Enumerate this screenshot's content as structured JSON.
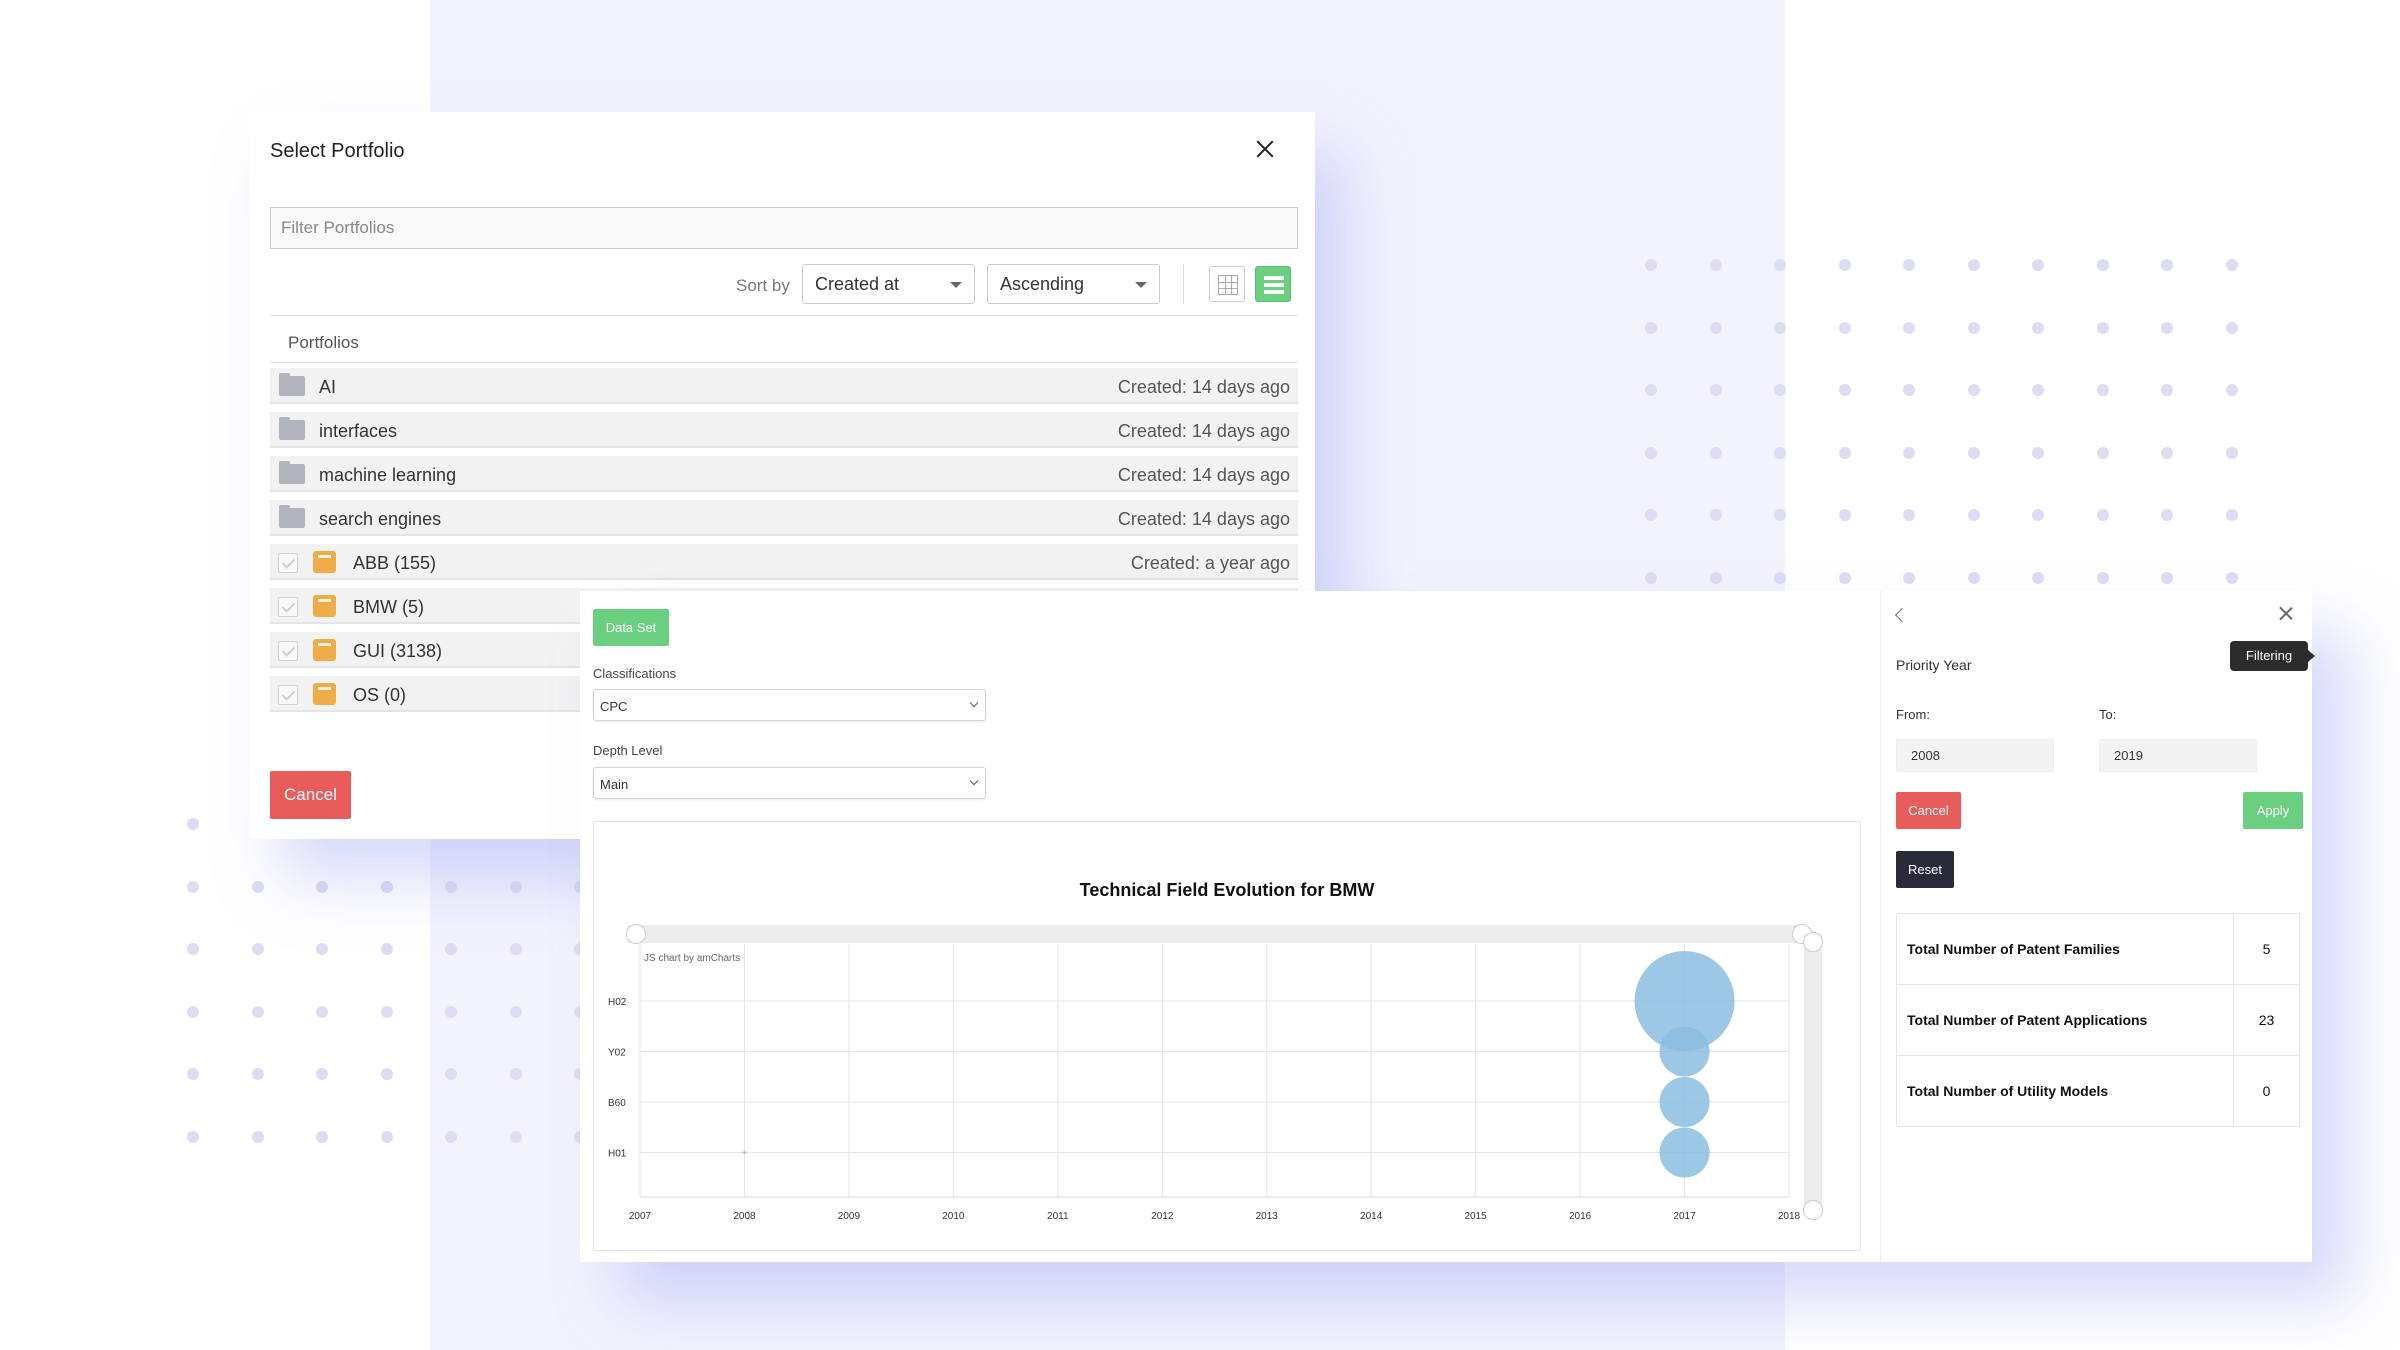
{
  "portfolio_modal": {
    "title": "Select Portfolio",
    "filter_placeholder": "Filter Portfolios",
    "sort_label": "Sort by",
    "sort_field": "Created at",
    "sort_order": "Ascending",
    "list_header": "Portfolios",
    "folders": [
      {
        "name": "AI",
        "created": "Created: 14 days ago"
      },
      {
        "name": "interfaces",
        "created": "Created: 14 days ago"
      },
      {
        "name": "machine learning",
        "created": "Created: 14 days ago"
      },
      {
        "name": "search engines",
        "created": "Created: 14 days ago"
      }
    ],
    "portfolios": [
      {
        "name": "ABB (155)",
        "created": "Created: a year ago"
      },
      {
        "name": "BMW (5)",
        "created": ""
      },
      {
        "name": "GUI (3138)",
        "created": ""
      },
      {
        "name": "OS (0)",
        "created": ""
      }
    ],
    "cancel_label": "Cancel"
  },
  "analysis": {
    "dataset_label": "Data Set",
    "classifications_label": "Classifications",
    "classifications_value": "CPC",
    "depth_label": "Depth Level",
    "depth_value": "Main",
    "credit": "JS chart by amCharts"
  },
  "filter_panel": {
    "heading": "Priority Year",
    "tooltip": "Filtering",
    "from_label": "From:",
    "to_label": "To:",
    "from_value": "2008",
    "to_value": "2019",
    "cancel_label": "Cancel",
    "apply_label": "Apply",
    "reset_label": "Reset",
    "stats": [
      {
        "label": "Total Number of Patent Families",
        "value": "5"
      },
      {
        "label": "Total Number of Patent Applications",
        "value": "23"
      },
      {
        "label": "Total Number of Utility Models",
        "value": "0"
      }
    ]
  },
  "colors": {
    "accent_green": "#6acf7f",
    "danger_red": "#e85c5c",
    "dark_button": "#2a2a3a",
    "bubble": "#8bbde0"
  },
  "chart_data": {
    "type": "scatter",
    "title": "Technical Field Evolution for BMW",
    "x_ticks": [
      "2007",
      "2008",
      "2009",
      "2010",
      "2011",
      "2012",
      "2013",
      "2014",
      "2015",
      "2016",
      "2017",
      "2018"
    ],
    "y_categories": [
      "H02",
      "Y02",
      "B60",
      "H01"
    ],
    "xlim": [
      2007,
      2018
    ],
    "grid": true,
    "series": [
      {
        "points": [
          {
            "x": 2008,
            "y": "H01",
            "size": 0.02
          },
          {
            "x": 2017,
            "y": "H02",
            "size": 1.0
          },
          {
            "x": 2017,
            "y": "Y02",
            "size": 0.5
          },
          {
            "x": 2017,
            "y": "B60",
            "size": 0.5
          },
          {
            "x": 2017,
            "y": "H01",
            "size": 0.5
          }
        ]
      }
    ]
  }
}
